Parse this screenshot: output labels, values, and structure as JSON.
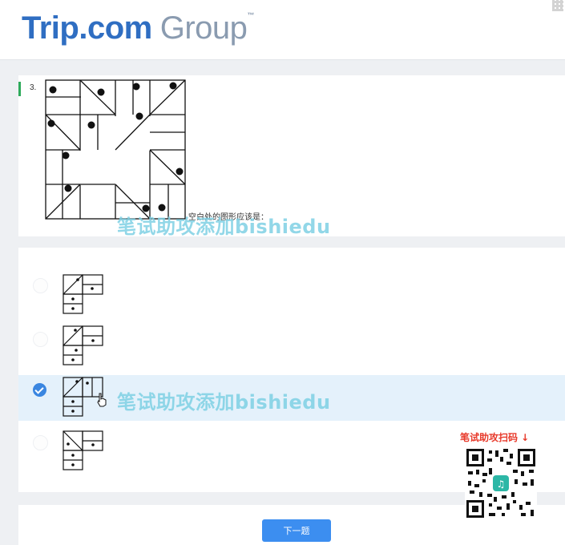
{
  "header": {
    "logo_trip": "Trip.com",
    "logo_group": "Group",
    "logo_tm": "™"
  },
  "question": {
    "number": "3.",
    "prompt": "空白处的图形应该是："
  },
  "options": [
    {
      "id": "A",
      "selected": false
    },
    {
      "id": "B",
      "selected": false
    },
    {
      "id": "C",
      "selected": true
    },
    {
      "id": "D",
      "selected": false
    }
  ],
  "footer": {
    "next_label": "下一题"
  },
  "overlay": {
    "watermark": "笔试助攻添加bishiedu",
    "promo": "笔试助攻扫码 ↓"
  },
  "colors": {
    "brand_blue": "#2f6ec2",
    "accent_button": "#3c8ef0",
    "selected_row": "#e4f1fb",
    "watermark": "#7fd1e4",
    "promo_red": "#e83a2b"
  }
}
